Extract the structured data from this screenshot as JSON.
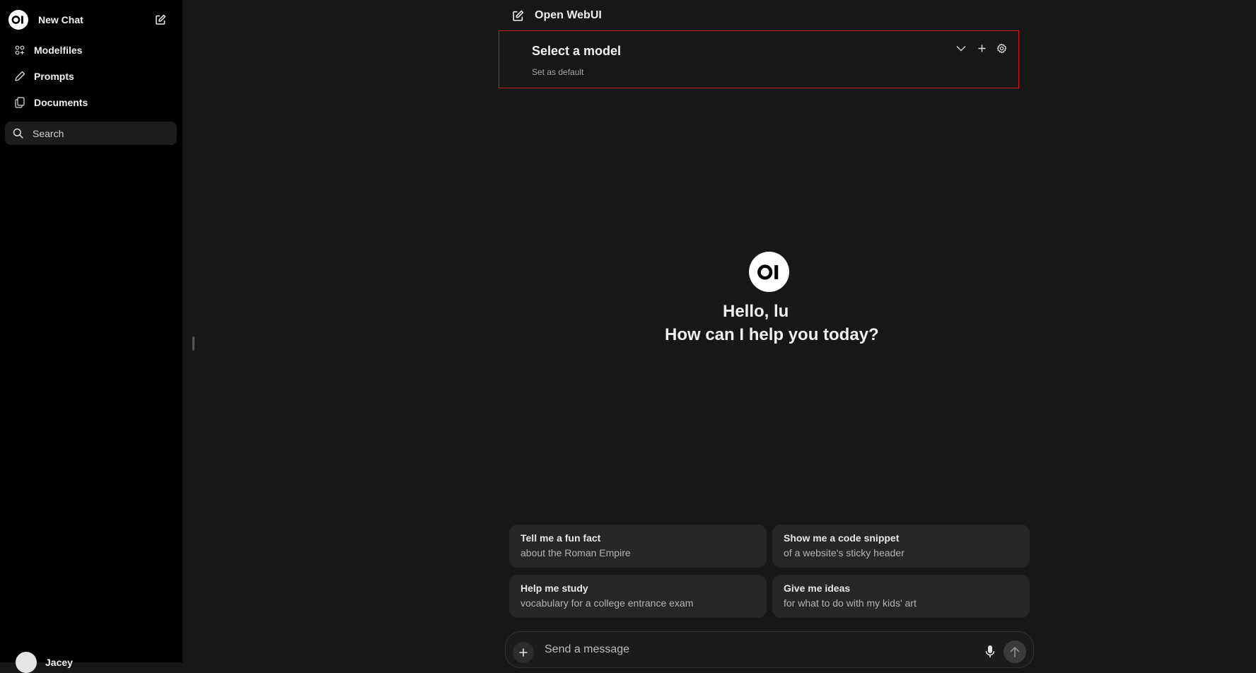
{
  "sidebar": {
    "new_chat_label": "New Chat",
    "items": [
      {
        "label": "Modelfiles",
        "icon": "modelfiles-icon"
      },
      {
        "label": "Prompts",
        "icon": "pencil-icon"
      },
      {
        "label": "Documents",
        "icon": "documents-icon"
      }
    ],
    "search_placeholder": "Search",
    "user_name": "Jacey"
  },
  "header": {
    "title": "Open WebUI"
  },
  "model_selector": {
    "title": "Select a model",
    "set_default": "Set as default"
  },
  "greeting": {
    "line1": "Hello, lu",
    "line2": "How can I help you today?"
  },
  "suggestions": [
    {
      "title": "Tell me a fun fact",
      "subtitle": "about the Roman Empire"
    },
    {
      "title": "Show me a code snippet",
      "subtitle": "of a website's sticky header"
    },
    {
      "title": "Help me study",
      "subtitle": "vocabulary for a college entrance exam"
    },
    {
      "title": "Give me ideas",
      "subtitle": "for what to do with my kids' art"
    }
  ],
  "composer": {
    "placeholder": "Send a message"
  },
  "colors": {
    "background": "#171717",
    "sidebar": "#000000",
    "highlight_border": "#d11a1a",
    "card": "#262626"
  }
}
